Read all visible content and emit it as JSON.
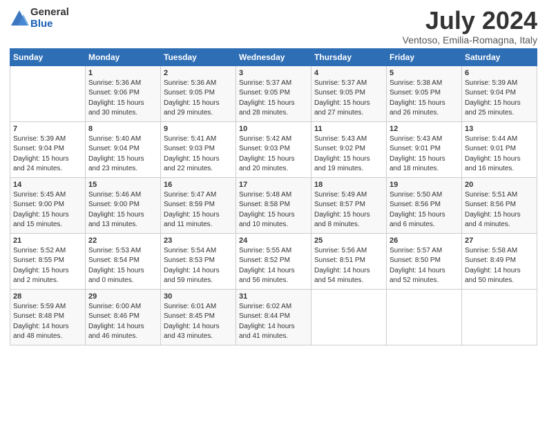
{
  "logo": {
    "general": "General",
    "blue": "Blue"
  },
  "title": "July 2024",
  "location": "Ventoso, Emilia-Romagna, Italy",
  "days_of_week": [
    "Sunday",
    "Monday",
    "Tuesday",
    "Wednesday",
    "Thursday",
    "Friday",
    "Saturday"
  ],
  "weeks": [
    [
      {
        "day": "",
        "info": ""
      },
      {
        "day": "1",
        "info": "Sunrise: 5:36 AM\nSunset: 9:06 PM\nDaylight: 15 hours\nand 30 minutes."
      },
      {
        "day": "2",
        "info": "Sunrise: 5:36 AM\nSunset: 9:05 PM\nDaylight: 15 hours\nand 29 minutes."
      },
      {
        "day": "3",
        "info": "Sunrise: 5:37 AM\nSunset: 9:05 PM\nDaylight: 15 hours\nand 28 minutes."
      },
      {
        "day": "4",
        "info": "Sunrise: 5:37 AM\nSunset: 9:05 PM\nDaylight: 15 hours\nand 27 minutes."
      },
      {
        "day": "5",
        "info": "Sunrise: 5:38 AM\nSunset: 9:05 PM\nDaylight: 15 hours\nand 26 minutes."
      },
      {
        "day": "6",
        "info": "Sunrise: 5:39 AM\nSunset: 9:04 PM\nDaylight: 15 hours\nand 25 minutes."
      }
    ],
    [
      {
        "day": "7",
        "info": "Sunrise: 5:39 AM\nSunset: 9:04 PM\nDaylight: 15 hours\nand 24 minutes."
      },
      {
        "day": "8",
        "info": "Sunrise: 5:40 AM\nSunset: 9:04 PM\nDaylight: 15 hours\nand 23 minutes."
      },
      {
        "day": "9",
        "info": "Sunrise: 5:41 AM\nSunset: 9:03 PM\nDaylight: 15 hours\nand 22 minutes."
      },
      {
        "day": "10",
        "info": "Sunrise: 5:42 AM\nSunset: 9:03 PM\nDaylight: 15 hours\nand 20 minutes."
      },
      {
        "day": "11",
        "info": "Sunrise: 5:43 AM\nSunset: 9:02 PM\nDaylight: 15 hours\nand 19 minutes."
      },
      {
        "day": "12",
        "info": "Sunrise: 5:43 AM\nSunset: 9:01 PM\nDaylight: 15 hours\nand 18 minutes."
      },
      {
        "day": "13",
        "info": "Sunrise: 5:44 AM\nSunset: 9:01 PM\nDaylight: 15 hours\nand 16 minutes."
      }
    ],
    [
      {
        "day": "14",
        "info": "Sunrise: 5:45 AM\nSunset: 9:00 PM\nDaylight: 15 hours\nand 15 minutes."
      },
      {
        "day": "15",
        "info": "Sunrise: 5:46 AM\nSunset: 9:00 PM\nDaylight: 15 hours\nand 13 minutes."
      },
      {
        "day": "16",
        "info": "Sunrise: 5:47 AM\nSunset: 8:59 PM\nDaylight: 15 hours\nand 11 minutes."
      },
      {
        "day": "17",
        "info": "Sunrise: 5:48 AM\nSunset: 8:58 PM\nDaylight: 15 hours\nand 10 minutes."
      },
      {
        "day": "18",
        "info": "Sunrise: 5:49 AM\nSunset: 8:57 PM\nDaylight: 15 hours\nand 8 minutes."
      },
      {
        "day": "19",
        "info": "Sunrise: 5:50 AM\nSunset: 8:56 PM\nDaylight: 15 hours\nand 6 minutes."
      },
      {
        "day": "20",
        "info": "Sunrise: 5:51 AM\nSunset: 8:56 PM\nDaylight: 15 hours\nand 4 minutes."
      }
    ],
    [
      {
        "day": "21",
        "info": "Sunrise: 5:52 AM\nSunset: 8:55 PM\nDaylight: 15 hours\nand 2 minutes."
      },
      {
        "day": "22",
        "info": "Sunrise: 5:53 AM\nSunset: 8:54 PM\nDaylight: 15 hours\nand 0 minutes."
      },
      {
        "day": "23",
        "info": "Sunrise: 5:54 AM\nSunset: 8:53 PM\nDaylight: 14 hours\nand 59 minutes."
      },
      {
        "day": "24",
        "info": "Sunrise: 5:55 AM\nSunset: 8:52 PM\nDaylight: 14 hours\nand 56 minutes."
      },
      {
        "day": "25",
        "info": "Sunrise: 5:56 AM\nSunset: 8:51 PM\nDaylight: 14 hours\nand 54 minutes."
      },
      {
        "day": "26",
        "info": "Sunrise: 5:57 AM\nSunset: 8:50 PM\nDaylight: 14 hours\nand 52 minutes."
      },
      {
        "day": "27",
        "info": "Sunrise: 5:58 AM\nSunset: 8:49 PM\nDaylight: 14 hours\nand 50 minutes."
      }
    ],
    [
      {
        "day": "28",
        "info": "Sunrise: 5:59 AM\nSunset: 8:48 PM\nDaylight: 14 hours\nand 48 minutes."
      },
      {
        "day": "29",
        "info": "Sunrise: 6:00 AM\nSunset: 8:46 PM\nDaylight: 14 hours\nand 46 minutes."
      },
      {
        "day": "30",
        "info": "Sunrise: 6:01 AM\nSunset: 8:45 PM\nDaylight: 14 hours\nand 43 minutes."
      },
      {
        "day": "31",
        "info": "Sunrise: 6:02 AM\nSunset: 8:44 PM\nDaylight: 14 hours\nand 41 minutes."
      },
      {
        "day": "",
        "info": ""
      },
      {
        "day": "",
        "info": ""
      },
      {
        "day": "",
        "info": ""
      }
    ]
  ]
}
